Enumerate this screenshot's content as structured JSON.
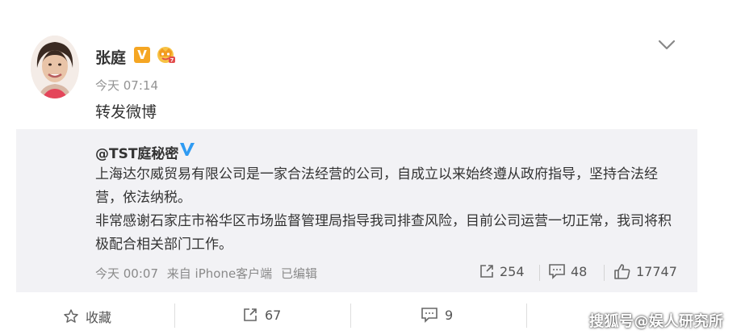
{
  "post": {
    "author": "张庭",
    "verified_badge": "V",
    "time": "今天 07:14",
    "text": "转发微博"
  },
  "repost": {
    "author": "@TST庭秘密",
    "paragraphs": [
      "上海达尔威贸易有限公司是一家合法经营的公司，自成立以来始终遵从政府指导，坚持合法经营，依法纳税。",
      "非常感谢石家庄市裕华区市场监督管理局指导我司排查风险，目前公司运营一切正常，我司将积极配合相关部门工作。"
    ],
    "time": "今天 00:07",
    "source": "来自 iPhone客户端",
    "edited": "已编辑",
    "shares": "254",
    "comments": "48",
    "likes": "17747"
  },
  "actions": {
    "favorite_label": "收藏",
    "forward_count": "67",
    "comment_count": "9"
  },
  "watermark": "搜狐号@娱人研究所",
  "colors": {
    "orange_badge": "#f5a623",
    "blue_badge": "#2f9bf2",
    "repost_bg": "#f2f2f5"
  },
  "icons": [
    "chevron-down-icon",
    "crown-icon",
    "blue-v-icon",
    "share-icon",
    "comment-icon",
    "like-icon",
    "star-icon"
  ]
}
